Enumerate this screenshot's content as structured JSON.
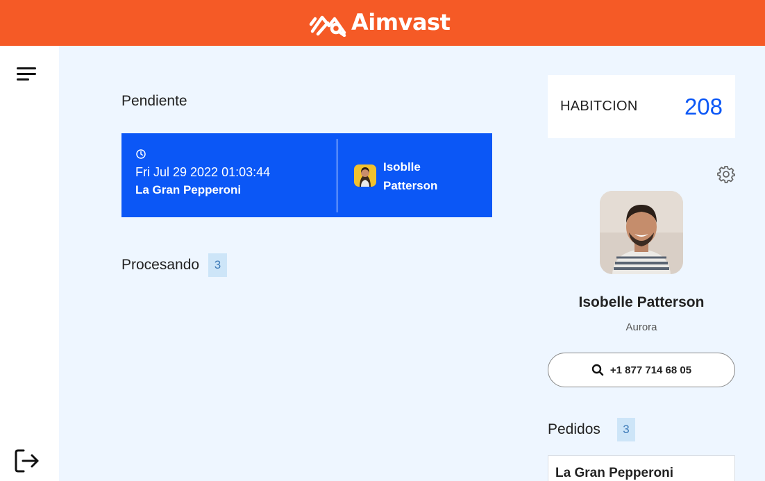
{
  "app": {
    "brand": "Aimvast",
    "brand_color": "#F55A26"
  },
  "sidebar": {
    "menu_icon": "hamburger-menu-icon",
    "logout_icon": "logout-icon"
  },
  "pending": {
    "title": "Pendiente",
    "order": {
      "datetime": "Fri Jul 29 2022 01:03:44",
      "restaurant": "La Gran Pepperoni",
      "customer_first": "Isoblle",
      "customer_last": "Patterson"
    }
  },
  "processing": {
    "title": "Procesando",
    "count": "3"
  },
  "room": {
    "label": "HABITCION",
    "number": "208"
  },
  "profile": {
    "name": "Isobelle Patterson",
    "location": "Aurora",
    "phone": "+1 877 714 68 05"
  },
  "orders": {
    "title": "Pedidos",
    "count": "3",
    "items": [
      {
        "name": "La Gran Pepperoni"
      }
    ]
  },
  "colors": {
    "accent_blue": "#0B57F6",
    "badge_bg": "#CDE5F8",
    "page_bg": "#EEF6FF"
  }
}
